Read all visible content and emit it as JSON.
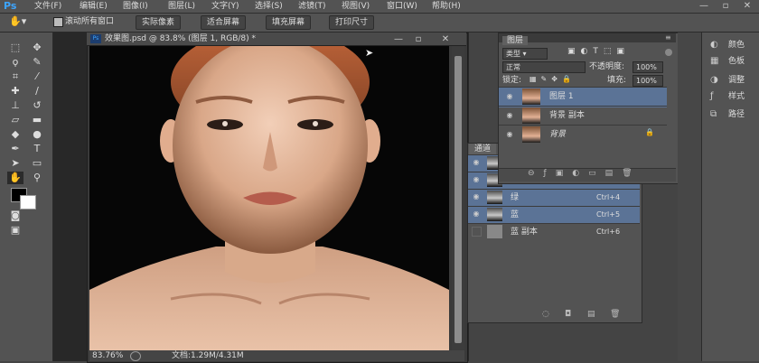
{
  "app": {
    "logo": "Ps"
  },
  "menu": [
    "文件(F)",
    "编辑(E)",
    "图像(I)",
    "图层(L)",
    "文字(Y)",
    "选择(S)",
    "滤镜(T)",
    "视图(V)",
    "窗口(W)",
    "帮助(H)"
  ],
  "window_controls": {
    "minimize": "—",
    "maximize": "▫",
    "close": "✕"
  },
  "options": {
    "scroll_all_label": "滚动所有窗口",
    "btn_actual": "实际像素",
    "btn_fit": "适合屏幕",
    "btn_fill": "填充屏幕",
    "btn_print": "打印尺寸"
  },
  "document": {
    "title": "效果图.psd @ 83.8% (图层 1, RGB/8) *",
    "zoom": "83.76%",
    "doc_size": "文档:1.29M/4.31M"
  },
  "layers": {
    "tab": "图层",
    "kind": "类型",
    "blend": "正常",
    "opacity_label": "不透明度:",
    "opacity_value": "100%",
    "lock_label": "锁定:",
    "fill_label": "填充:",
    "fill_value": "100%",
    "items": [
      {
        "name": "图层 1",
        "selected": true
      },
      {
        "name": "背景 副本",
        "selected": false
      },
      {
        "name": "背景",
        "selected": false
      }
    ]
  },
  "channels": {
    "tab": "通道",
    "items": [
      {
        "name": "",
        "shortcut": "",
        "selected": true
      },
      {
        "name": "",
        "shortcut": "",
        "selected": true
      },
      {
        "name": "绿",
        "shortcut": "Ctrl+4",
        "selected": true
      },
      {
        "name": "蓝",
        "shortcut": "Ctrl+5",
        "selected": true
      },
      {
        "name": "蓝 副本",
        "shortcut": "Ctrl+6",
        "selected": false
      }
    ]
  },
  "dock": {
    "items": [
      {
        "label": "颜色",
        "icon": "color-icon"
      },
      {
        "label": "色板",
        "icon": "swatches-icon"
      },
      {
        "label": "调整",
        "icon": "adjustments-icon"
      },
      {
        "label": "样式",
        "icon": "styles-icon"
      },
      {
        "label": "路径",
        "icon": "paths-icon"
      }
    ]
  },
  "colors": {
    "accent": "#5b7396",
    "ps_blue": "#3da5ff"
  }
}
